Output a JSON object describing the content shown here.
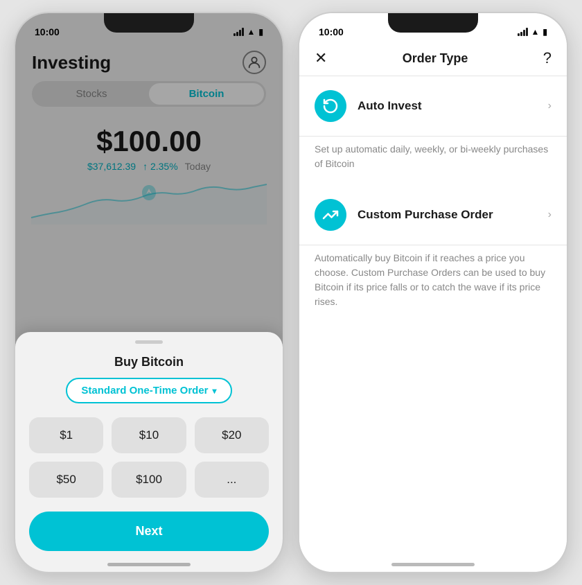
{
  "left_phone": {
    "status_bar": {
      "time": "10:00",
      "signal": "signal",
      "wifi": "wifi",
      "battery": "battery"
    },
    "header": {
      "title": "Investing",
      "avatar_label": "user avatar"
    },
    "tabs": [
      {
        "label": "Stocks",
        "active": false
      },
      {
        "label": "Bitcoin",
        "active": true
      }
    ],
    "price": {
      "main": "$100.00",
      "btc_price": "$37,612.39",
      "change": "↑ 2.35%",
      "period": "Today"
    },
    "bottom_sheet": {
      "title": "Buy Bitcoin",
      "order_type": "Standard One-Time Order",
      "order_type_chevron": "▾",
      "amounts": [
        "$1",
        "$10",
        "$20",
        "$50",
        "$100",
        "..."
      ],
      "next_button": "Next"
    }
  },
  "right_phone": {
    "status_bar": {
      "time": "10:00"
    },
    "header": {
      "close": "✕",
      "title": "Order Type",
      "help": "?"
    },
    "order_types": [
      {
        "id": "auto-invest",
        "icon": "↺",
        "title": "Auto Invest",
        "description": "Set up automatic daily, weekly, or bi-weekly purchases of Bitcoin"
      },
      {
        "id": "custom-purchase",
        "icon": "📈",
        "title": "Custom Purchase Order",
        "description": "Automatically buy Bitcoin if it reaches a price you choose. Custom Purchase Orders can be used to buy Bitcoin if its price falls or to catch the wave if its price rises."
      }
    ]
  }
}
